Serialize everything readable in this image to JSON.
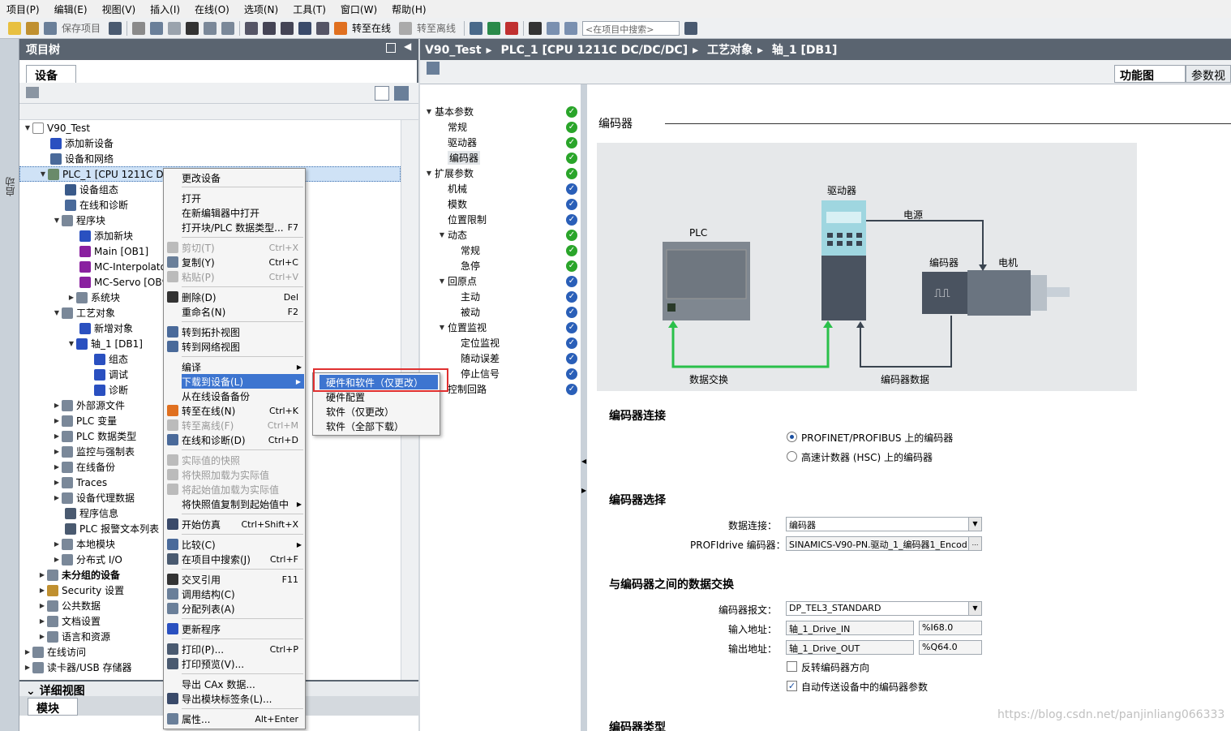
{
  "menubar": [
    "项目(P)",
    "编辑(E)",
    "视图(V)",
    "插入(I)",
    "在线(O)",
    "选项(N)",
    "工具(T)",
    "窗口(W)",
    "帮助(H)"
  ],
  "toolbar": {
    "save_project": "保存项目",
    "go_online": "转至在线",
    "go_offline": "转至离线",
    "search_placeholder": "<在项目中搜索>"
  },
  "sidebar_tab": "启动",
  "project_tree": {
    "title": "项目树",
    "devices_tab": "设备",
    "items": [
      {
        "label": "V90_Test"
      },
      {
        "label": "添加新设备"
      },
      {
        "label": "设备和网络"
      },
      {
        "label": "PLC_1 [CPU 1211C DC"
      },
      {
        "label": "设备组态"
      },
      {
        "label": "在线和诊断"
      },
      {
        "label": "程序块"
      },
      {
        "label": "添加新块"
      },
      {
        "label": "Main [OB1]"
      },
      {
        "label": "MC-Interpolator"
      },
      {
        "label": "MC-Servo [OB9"
      },
      {
        "label": "系统块"
      },
      {
        "label": "工艺对象"
      },
      {
        "label": "新增对象"
      },
      {
        "label": "轴_1 [DB1]"
      },
      {
        "label": "组态"
      },
      {
        "label": "调试"
      },
      {
        "label": "诊断"
      },
      {
        "label": "外部源文件"
      },
      {
        "label": "PLC 变量"
      },
      {
        "label": "PLC 数据类型"
      },
      {
        "label": "监控与强制表"
      },
      {
        "label": "在线备份"
      },
      {
        "label": "Traces"
      },
      {
        "label": "设备代理数据"
      },
      {
        "label": "程序信息"
      },
      {
        "label": "PLC 报警文本列表"
      },
      {
        "label": "本地模块"
      },
      {
        "label": "分布式 I/O"
      },
      {
        "label": "未分组的设备"
      },
      {
        "label": "Security 设置"
      },
      {
        "label": "公共数据"
      },
      {
        "label": "文档设置"
      },
      {
        "label": "语言和资源"
      },
      {
        "label": "在线访问"
      },
      {
        "label": "读卡器/USB 存储器"
      }
    ]
  },
  "detail_view": {
    "title": "详细视图",
    "modules_tab": "模块"
  },
  "context_menu": [
    {
      "label": "更改设备",
      "shortcut": ""
    },
    {
      "label": "打开",
      "shortcut": ""
    },
    {
      "label": "在新编辑器中打开",
      "shortcut": ""
    },
    {
      "label": "打开块/PLC 数据类型...",
      "shortcut": "F7"
    },
    {
      "label": "剪切(T)",
      "shortcut": "Ctrl+X"
    },
    {
      "label": "复制(Y)",
      "shortcut": "Ctrl+C"
    },
    {
      "label": "粘贴(P)",
      "shortcut": "Ctrl+V"
    },
    {
      "label": "删除(D)",
      "shortcut": "Del"
    },
    {
      "label": "重命名(N)",
      "shortcut": "F2"
    },
    {
      "label": "转到拓扑视图",
      "shortcut": ""
    },
    {
      "label": "转到网络视图",
      "shortcut": ""
    },
    {
      "label": "编译",
      "shortcut": ""
    },
    {
      "label": "下载到设备(L)",
      "shortcut": ""
    },
    {
      "label": "从在线设备备份",
      "shortcut": ""
    },
    {
      "label": "转至在线(N)",
      "shortcut": "Ctrl+K"
    },
    {
      "label": "转至离线(F)",
      "shortcut": "Ctrl+M"
    },
    {
      "label": "在线和诊断(D)",
      "shortcut": "Ctrl+D"
    },
    {
      "label": "实际值的快照",
      "shortcut": ""
    },
    {
      "label": "将快照加载为实际值",
      "shortcut": ""
    },
    {
      "label": "将起始值加载为实际值",
      "shortcut": ""
    },
    {
      "label": "将快照值复制到起始值中",
      "shortcut": ""
    },
    {
      "label": "开始仿真",
      "shortcut": "Ctrl+Shift+X"
    },
    {
      "label": "比较(C)",
      "shortcut": ""
    },
    {
      "label": "在项目中搜索(J)",
      "shortcut": "Ctrl+F"
    },
    {
      "label": "交叉引用",
      "shortcut": "F11"
    },
    {
      "label": "调用结构(C)",
      "shortcut": ""
    },
    {
      "label": "分配列表(A)",
      "shortcut": ""
    },
    {
      "label": "更新程序",
      "shortcut": ""
    },
    {
      "label": "打印(P)...",
      "shortcut": "Ctrl+P"
    },
    {
      "label": "打印预览(V)...",
      "shortcut": ""
    },
    {
      "label": "导出 CAx 数据...",
      "shortcut": ""
    },
    {
      "label": "导出模块标签条(L)...",
      "shortcut": ""
    },
    {
      "label": "属性...",
      "shortcut": "Alt+Enter"
    }
  ],
  "download_submenu": [
    "硬件和软件（仅更改）",
    "硬件配置",
    "软件（仅更改）",
    "软件（全部下载）"
  ],
  "breadcrumb": [
    "V90_Test",
    "PLC_1 [CPU 1211C DC/DC/DC]",
    "工艺对象",
    "轴_1 [DB1]"
  ],
  "right_tabs": {
    "function_view": "功能图",
    "params": "参数视"
  },
  "nav": [
    {
      "label": "基本参数"
    },
    {
      "label": "常规"
    },
    {
      "label": "驱动器"
    },
    {
      "label": "编码器"
    },
    {
      "label": "扩展参数"
    },
    {
      "label": "机械"
    },
    {
      "label": "模数"
    },
    {
      "label": "位置限制"
    },
    {
      "label": "动态"
    },
    {
      "label": "常规"
    },
    {
      "label": "急停"
    },
    {
      "label": "回原点"
    },
    {
      "label": "主动"
    },
    {
      "label": "被动"
    },
    {
      "label": "位置监视"
    },
    {
      "label": "定位监视"
    },
    {
      "label": "随动误差"
    },
    {
      "label": "停止信号"
    },
    {
      "label": "控制回路"
    }
  ],
  "encoder_page": {
    "title": "编码器",
    "diagram": {
      "plc": "PLC",
      "drive": "驱动器",
      "power": "电源",
      "encoder": "编码器",
      "motor": "电机",
      "data_exchange": "数据交换",
      "encoder_data": "编码器数据"
    },
    "connection": {
      "title": "编码器连接",
      "opt1": "PROFINET/PROFIBUS 上的编码器",
      "opt2": "高速计数器 (HSC) 上的编码器"
    },
    "selection": {
      "title": "编码器选择",
      "data_conn_label": "数据连接：",
      "data_conn_value": "编码器",
      "profidrive_label": "PROFIdrive 编码器：",
      "profidrive_value": "SINAMICS-V90-PN.驱动_1_编码器1_Encod"
    },
    "exchange": {
      "title": "与编码器之间的数据交换",
      "telegram_label": "编码器报文：",
      "telegram_value": "DP_TEL3_STANDARD",
      "input_label": "输入地址：",
      "input_value": "轴_1_Drive_IN",
      "input_addr": "%I68.0",
      "output_label": "输出地址：",
      "output_value": "轴_1_Drive_OUT",
      "output_addr": "%Q64.0",
      "reverse": "反转编码器方向",
      "auto": "自动传送设备中的编码器参数"
    },
    "type_title": "编码器类型"
  },
  "watermark": "https://blog.csdn.net/panjinliang066333"
}
